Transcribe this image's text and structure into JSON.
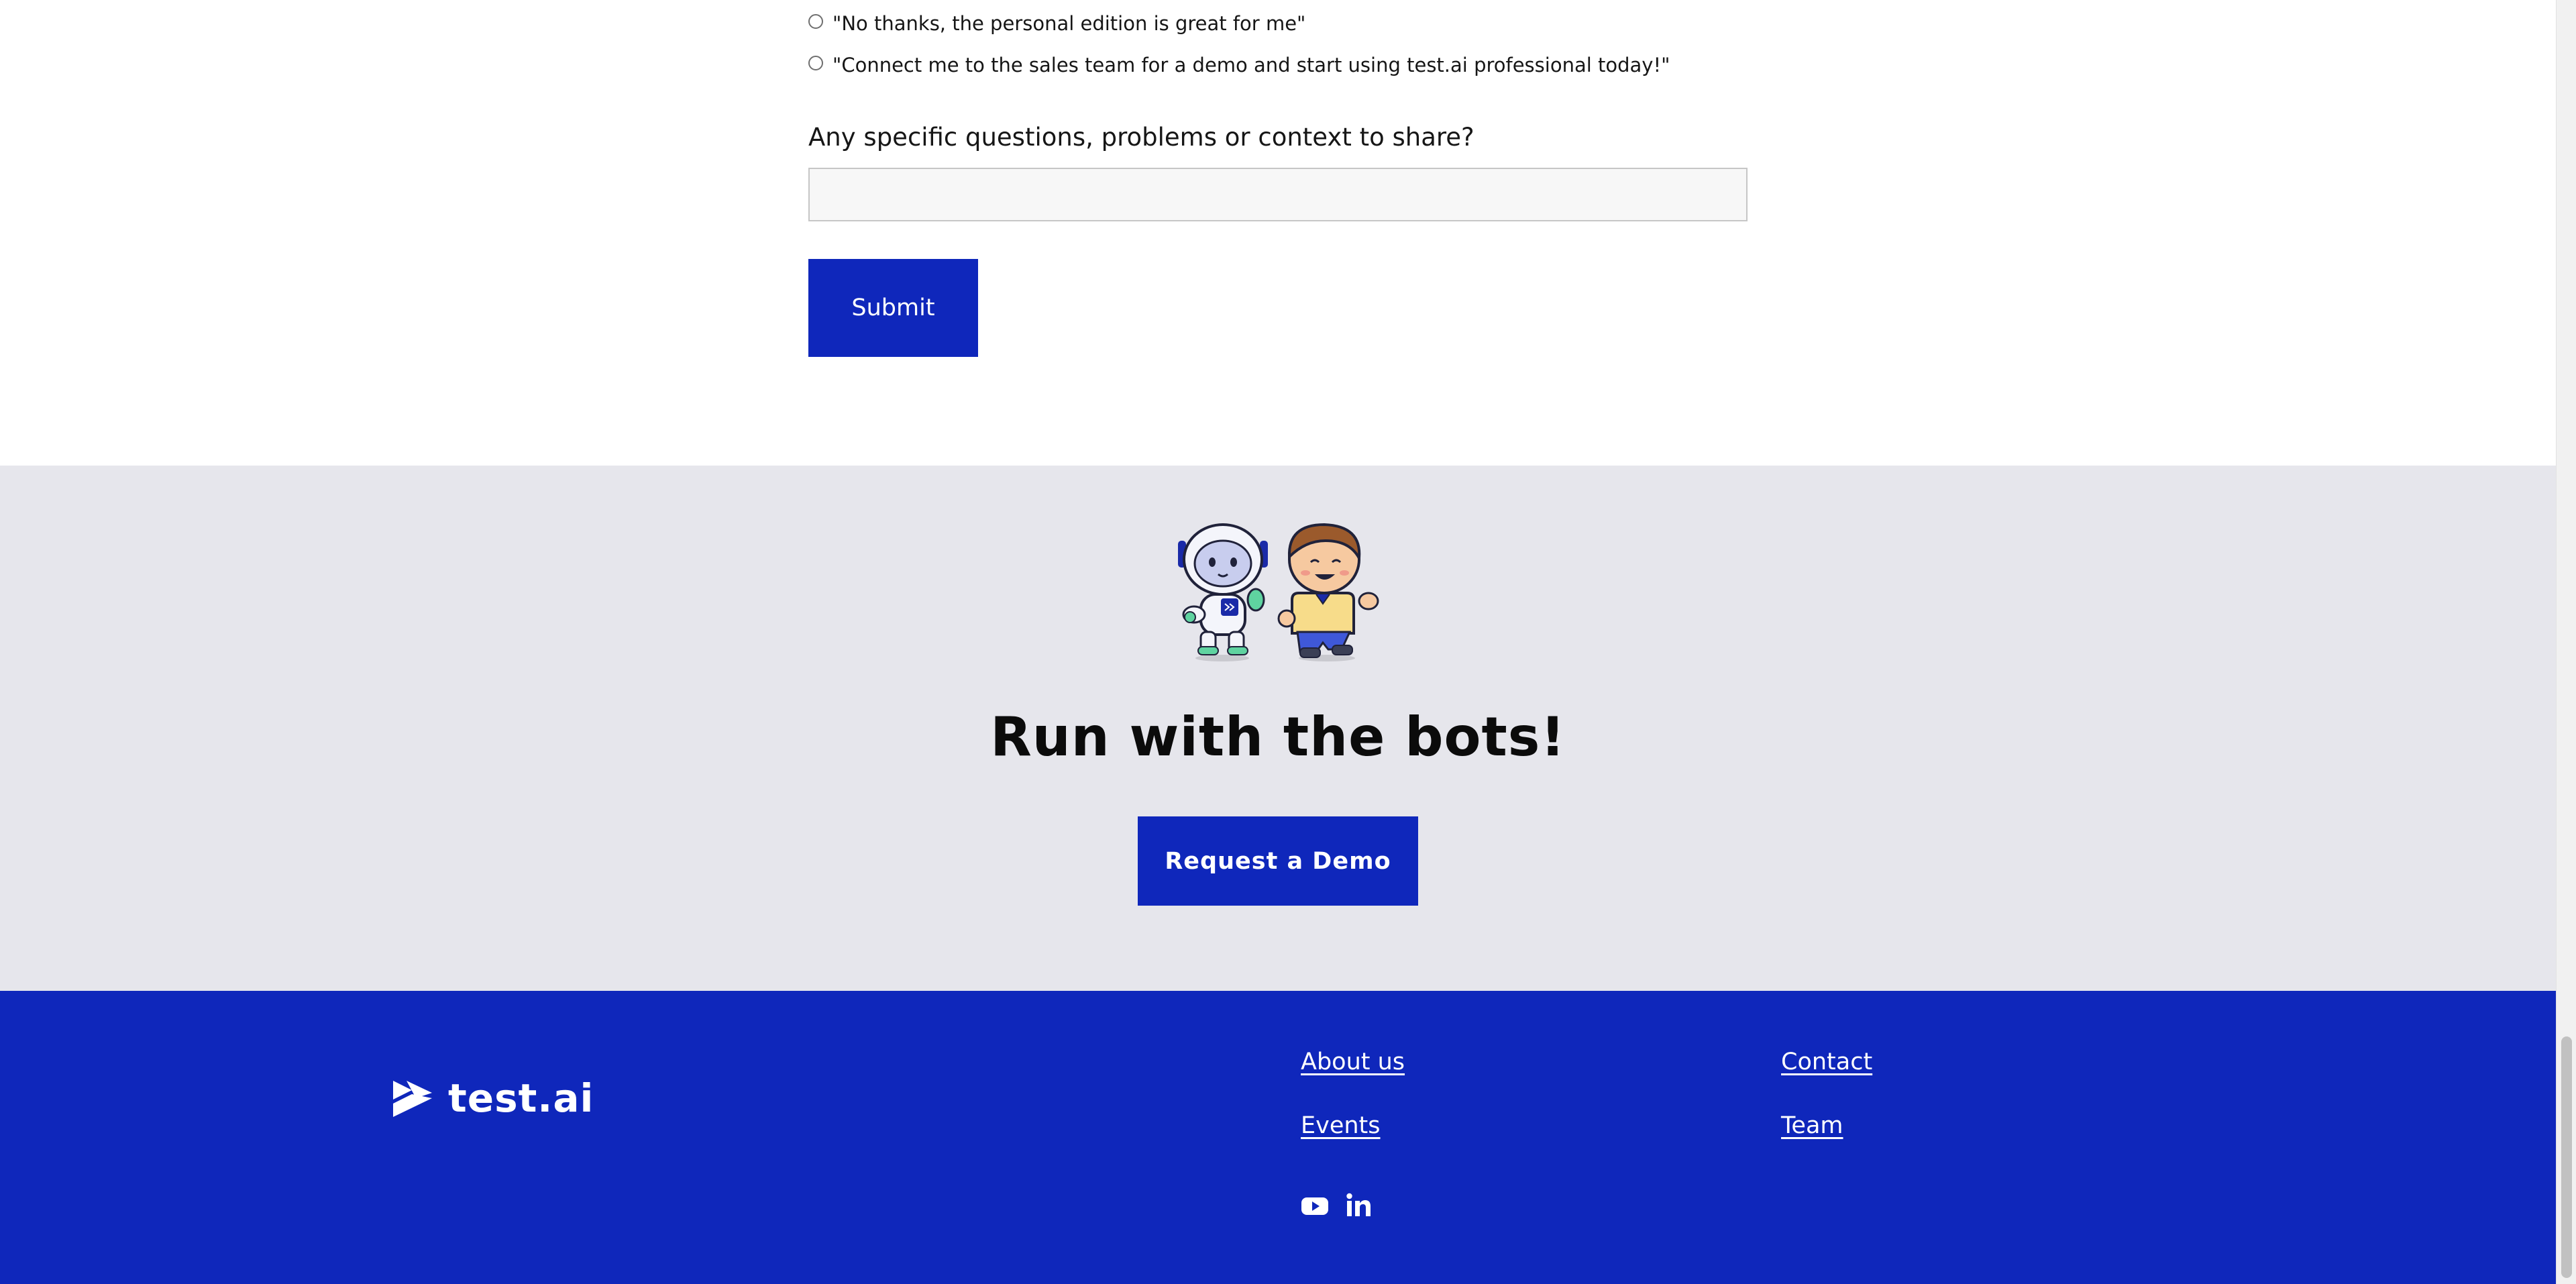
{
  "form": {
    "options": [
      {
        "label": "\"No thanks, the personal edition is great for me\""
      },
      {
        "label": "\"Connect me to the sales team for a demo and start using test.ai professional today!\""
      }
    ],
    "question_label": "Any specific questions, problems or context to share?",
    "question_value": "",
    "submit_label": "Submit"
  },
  "cta": {
    "title": "Run with the bots!",
    "button_label": "Request a Demo"
  },
  "footer": {
    "logo_text": "test.ai",
    "links": {
      "about": "About us",
      "events": "Events",
      "contact": "Contact",
      "team": "Team"
    },
    "social": [
      "youtube-icon",
      "linkedin-icon"
    ]
  },
  "colors": {
    "brand_blue": "#0f27bb",
    "cta_background": "#e6e6ec",
    "input_background": "#f7f7f7"
  }
}
